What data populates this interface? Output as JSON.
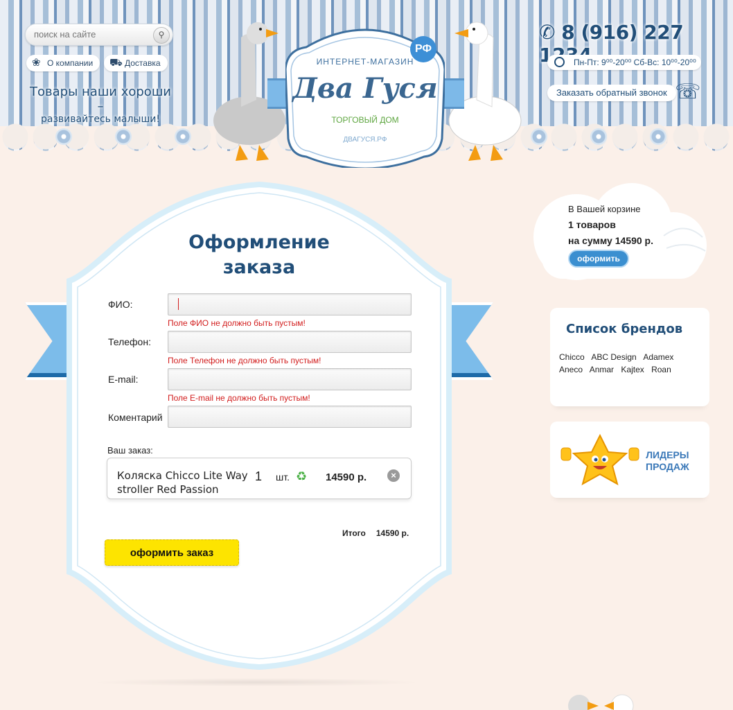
{
  "header": {
    "search_placeholder": "поиск на сайте",
    "nav": [
      {
        "label": "О компании",
        "icon": "goose-icon"
      },
      {
        "label": "Доставка",
        "icon": "truck-icon"
      }
    ],
    "slogan_line1": "Товары наши хороши –",
    "slogan_line2": "развивайтесь малыши!",
    "logo": {
      "top": "ИНТЕРНЕТ-МАГАЗИН",
      "name": "Два Гуся",
      "badge": "РФ",
      "sub": "ТОРГОВЫЙ ДОМ",
      "domain": "ДВАГУСЯ.РФ"
    },
    "phone": "8 (916) 227 1234",
    "hours": "Пн-Пт: 9⁰⁰-20⁰⁰   Сб-Вс: 10⁰⁰-20⁰⁰",
    "callback": "Заказать обратный звонок"
  },
  "order_form": {
    "title_line1": "Оформление",
    "title_line2": "заказа",
    "fields": [
      {
        "label": "ФИО:",
        "value": "",
        "error": "Поле ФИО не должно быть пустым!"
      },
      {
        "label": "Телефон:",
        "value": "",
        "error": "Поле Телефон не должно быть пустым!"
      },
      {
        "label": "E-mail:",
        "value": "",
        "error": "Поле E-mail не должно быть пустым!"
      },
      {
        "label": "Коментарий",
        "value": ""
      }
    ],
    "order_label": "Ваш заказ:",
    "items": [
      {
        "name": "Коляска Chicco Lite Way stroller Red Passion",
        "qty": "1",
        "unit": "шт.",
        "price": "14590 р."
      }
    ],
    "total_label": "Итого",
    "total_value": "14590 р.",
    "submit_label": "оформить заказ"
  },
  "cart": {
    "line1": "В Вашей корзине",
    "line2": "1 товаров",
    "line3": "на сумму 14590 р.",
    "button": "оформить"
  },
  "brands": {
    "title": "Список брендов",
    "items": [
      "Chicco",
      "ABC Design",
      "Adamex",
      "Aneco",
      "Anmar",
      "Kajtex",
      "Roan"
    ]
  },
  "leaders": {
    "line1": "ЛИДЕРЫ",
    "line2": "ПРОДАЖ"
  },
  "colors": {
    "brand_blue": "#214e78",
    "ribbon": "#7cbcea",
    "button_yellow": "#fde400",
    "error": "#d21d1d"
  }
}
